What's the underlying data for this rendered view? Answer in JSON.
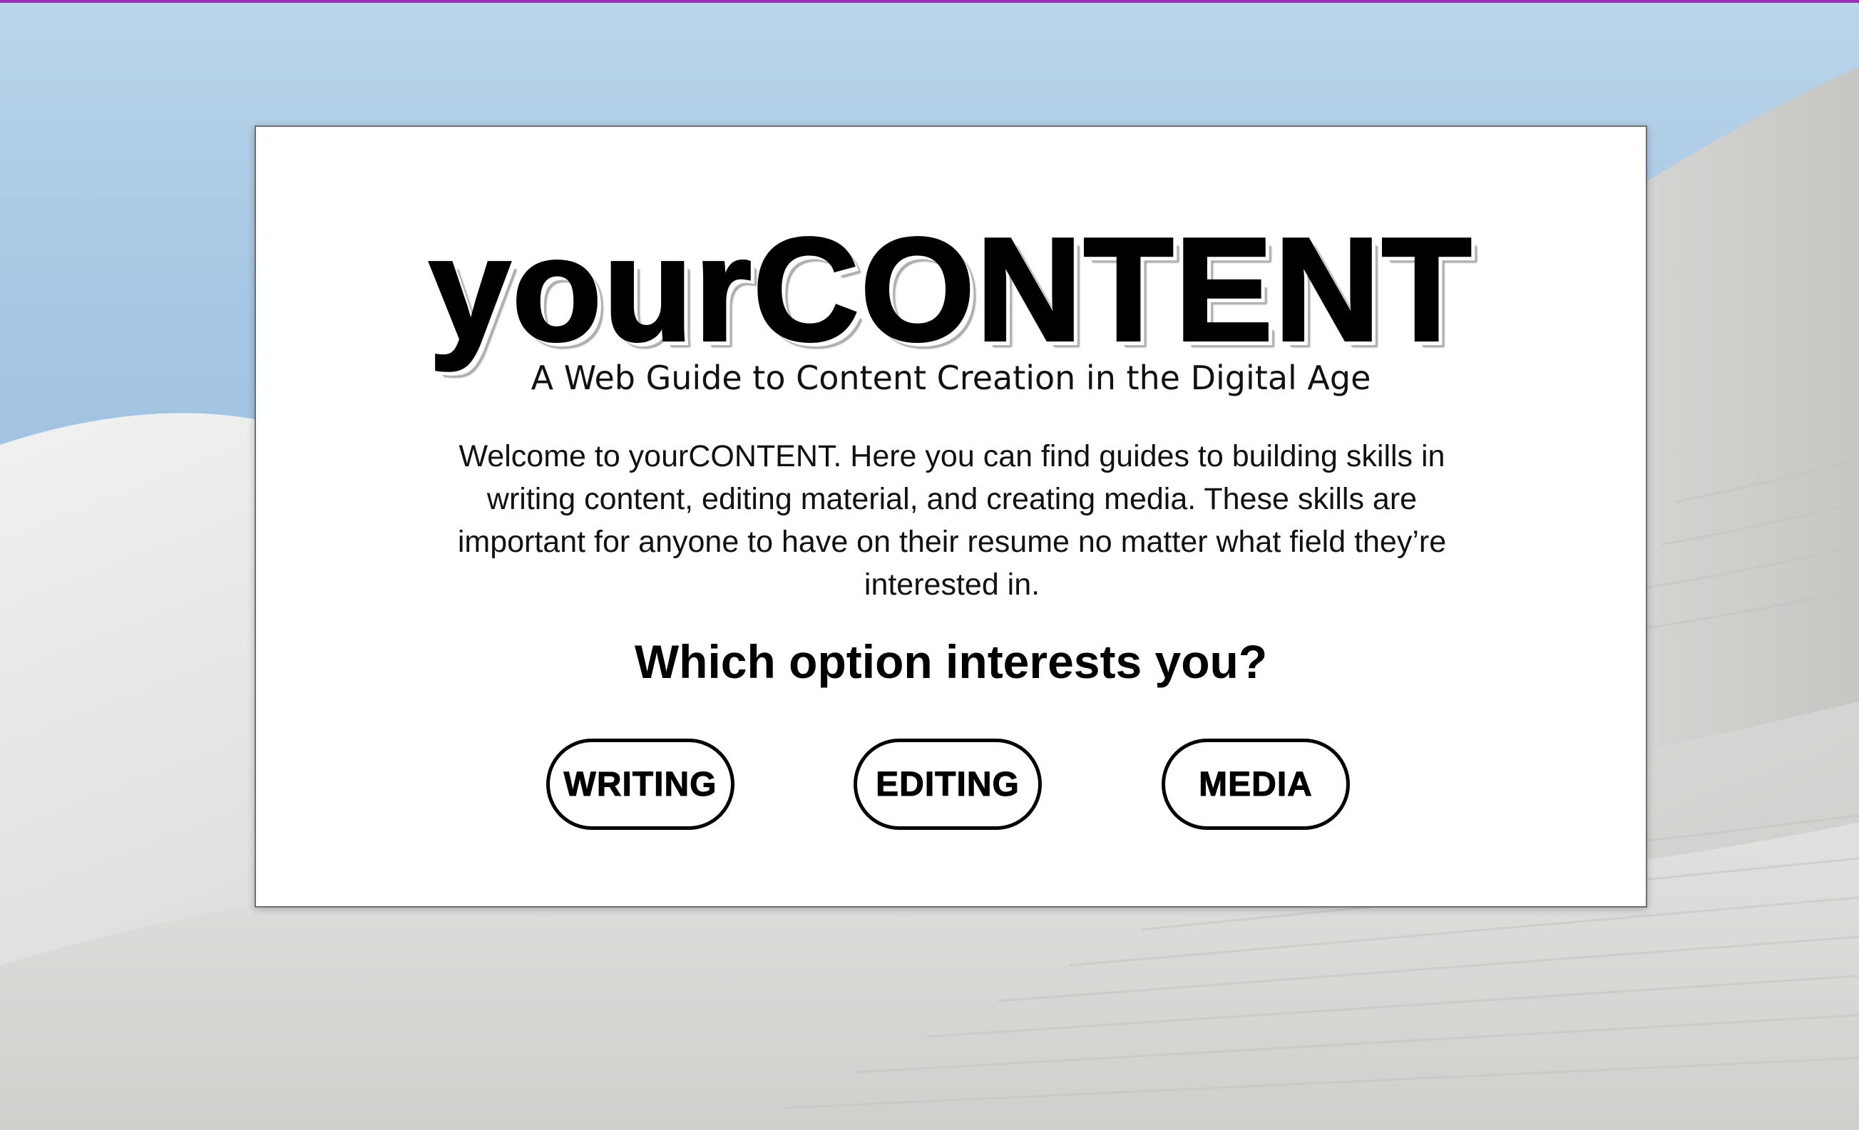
{
  "accent_color": "#9b2fb5",
  "hero": {
    "title": "yourCONTENT",
    "subtitle": "A Web Guide to Content Creation in the Digital Age",
    "intro": "Welcome to yourCONTENT. Here you can find guides to building skills in writing content, editing material, and creating media. These skills are important for anyone to have on their resume no matter what field they’re interested in."
  },
  "question": "Which option interests you?",
  "options": [
    {
      "label": "WRITING"
    },
    {
      "label": "EDITING"
    },
    {
      "label": "MEDIA"
    }
  ]
}
